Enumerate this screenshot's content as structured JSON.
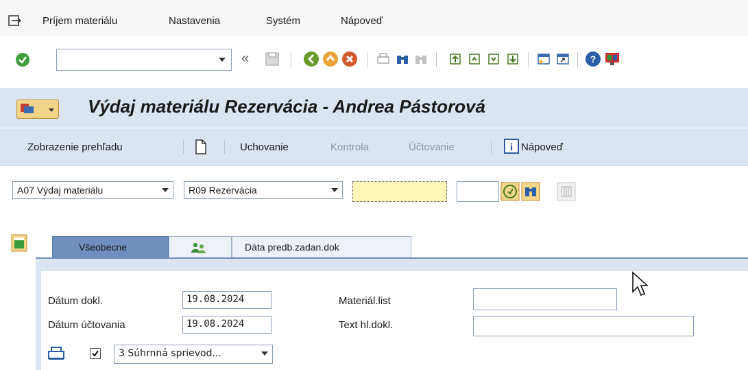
{
  "menu": {
    "items": [
      "Príjem materiálu",
      "Nastavenia",
      "Systém",
      "Nápoveď"
    ]
  },
  "toolbar": {
    "command_field_value": "",
    "back_glyph": "«"
  },
  "title": {
    "text": "Výdaj materiálu Rezervácia - Andrea Pástorová"
  },
  "app_toolbar": {
    "overview": "Zobrazenie prehľadu",
    "hold": "Uchovanie",
    "check": "Kontrola",
    "post": "Účtovanie",
    "help": "Nápoveď"
  },
  "selectors": {
    "transaction": "A07 Výdaj materiálu",
    "reference": "R09 Rezervácia",
    "reservation_number": "",
    "item": ""
  },
  "tabs": [
    {
      "label": "Všeobecne"
    },
    {
      "label": ""
    },
    {
      "label": "Dáta predb.zadan.dok"
    }
  ],
  "form": {
    "doc_date_label": "Dátum dokl.",
    "doc_date_value": "19.08.2024",
    "post_date_label": "Dátum účtovania",
    "post_date_value": "19.08.2024",
    "material_slip_label": "Materiál.list",
    "material_slip_value": "",
    "header_text_label": "Text hl.dokl.",
    "header_text_value": "",
    "print_option": "3 Súhrnná sprievod..."
  },
  "colors": {
    "title_bg": "#dbe4f1",
    "required_field": "#fff6b8",
    "accent": "#6f8fbf"
  }
}
